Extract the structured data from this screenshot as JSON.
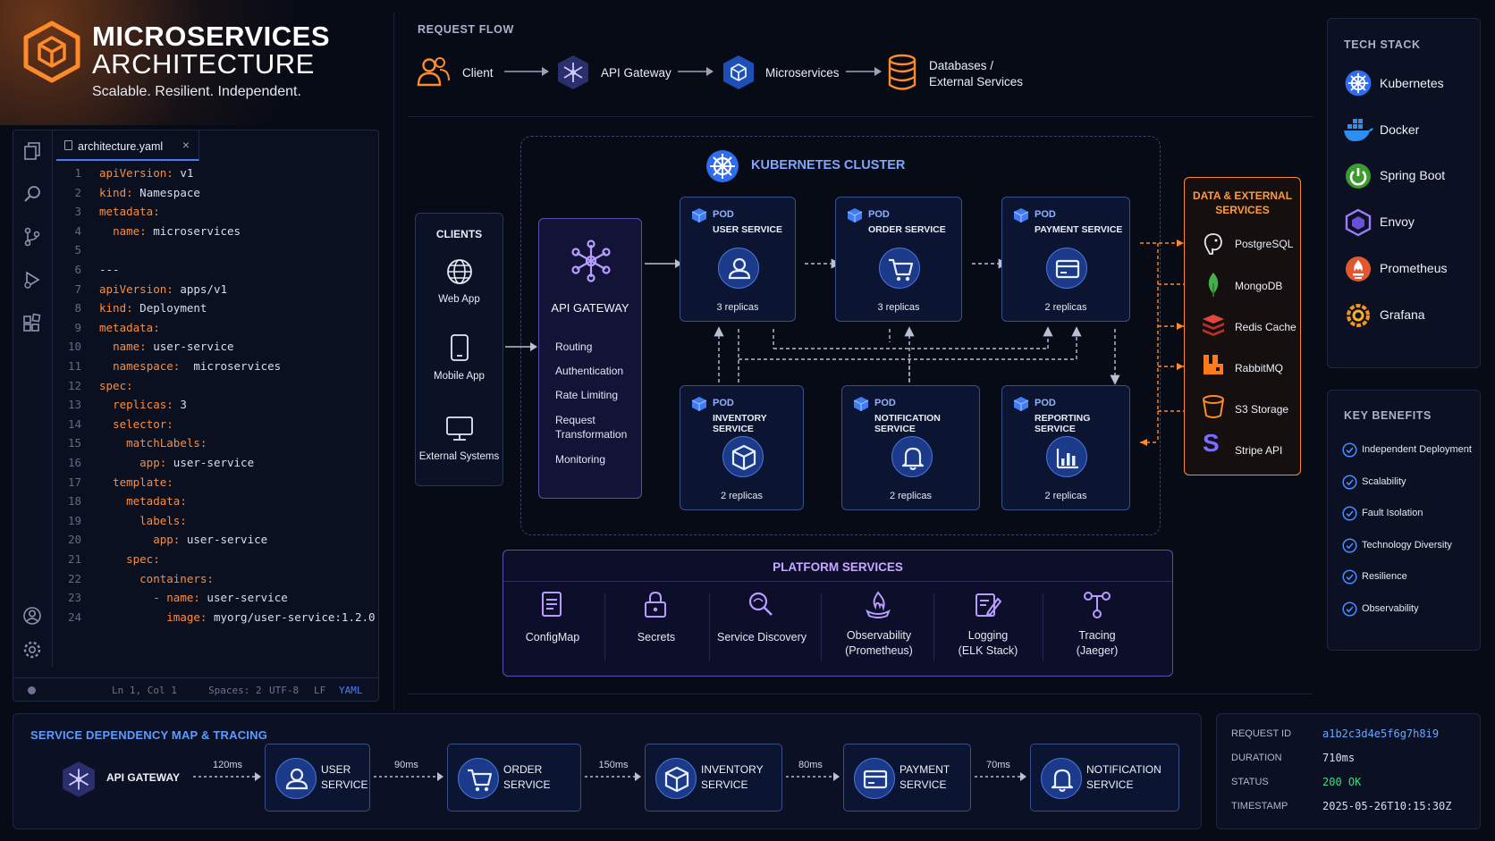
{
  "title": {
    "line1": "MICROSERVICES",
    "line2": "ARCHITECTURE",
    "subtitle": "Scalable. Resilient. Independent."
  },
  "editor": {
    "tab_name": "architecture.yaml",
    "lines": [
      {
        "n": "1",
        "indent": "",
        "key": "apiVersion:",
        "val": " v1"
      },
      {
        "n": "2",
        "indent": "",
        "key": "kind:",
        "val": " Namespace"
      },
      {
        "n": "3",
        "indent": "",
        "key": "metadata:",
        "val": ""
      },
      {
        "n": "4",
        "indent": "  ",
        "key": "name:",
        "val": " microservices"
      },
      {
        "n": "5",
        "indent": "",
        "key": "",
        "val": ""
      },
      {
        "n": "6",
        "indent": "",
        "key": "",
        "val": "---"
      },
      {
        "n": "7",
        "indent": "",
        "key": "apiVersion:",
        "val": " apps/v1"
      },
      {
        "n": "8",
        "indent": "",
        "key": "kind:",
        "val": " Deployment"
      },
      {
        "n": "9",
        "indent": "",
        "key": "metadata:",
        "val": ""
      },
      {
        "n": "10",
        "indent": "  ",
        "key": "name:",
        "val": " user-service"
      },
      {
        "n": "11",
        "indent": "  ",
        "key": "namespace:",
        "val": "  microservices"
      },
      {
        "n": "12",
        "indent": "",
        "key": "spec:",
        "val": ""
      },
      {
        "n": "13",
        "indent": "  ",
        "key": "replicas:",
        "val": " 3"
      },
      {
        "n": "14",
        "indent": "  ",
        "key": "selector:",
        "val": ""
      },
      {
        "n": "15",
        "indent": "    ",
        "key": "matchLabels:",
        "val": ""
      },
      {
        "n": "16",
        "indent": "      ",
        "key": "app:",
        "val": " user-service"
      },
      {
        "n": "17",
        "indent": "  ",
        "key": "template:",
        "val": ""
      },
      {
        "n": "18",
        "indent": "    ",
        "key": "metadata:",
        "val": ""
      },
      {
        "n": "19",
        "indent": "      ",
        "key": "labels:",
        "val": ""
      },
      {
        "n": "20",
        "indent": "        ",
        "key": "app:",
        "val": " user-service"
      },
      {
        "n": "21",
        "indent": "    ",
        "key": "spec:",
        "val": ""
      },
      {
        "n": "22",
        "indent": "      ",
        "key": "containers:",
        "val": ""
      },
      {
        "n": "23",
        "indent": "        ",
        "key": "- name:",
        "val": " user-service"
      },
      {
        "n": "24",
        "indent": "          ",
        "key": "image:",
        "val": " myorg/user-service:1.2.0"
      }
    ],
    "status": {
      "position": "Ln 1, Col 1",
      "spaces": "Spaces: 2",
      "encoding": "UTF-8",
      "eol": "LF",
      "language": "YAML"
    }
  },
  "request_flow": {
    "label": "REQUEST FLOW",
    "steps": [
      "Client",
      "API Gateway",
      "Microservices"
    ],
    "last_step": {
      "line1": "Databases /",
      "line2": "External Services"
    }
  },
  "cluster": {
    "title": "KUBERNETES CLUSTER"
  },
  "clients": {
    "title": "CLIENTS",
    "items": [
      "Web App",
      "Mobile App",
      "External Systems"
    ]
  },
  "gateway": {
    "title": "API GATEWAY",
    "items": [
      "Routing",
      "Authentication",
      "Rate Limiting",
      "Request",
      "Transformation",
      "Monitoring"
    ]
  },
  "pods": [
    {
      "tag": "POD",
      "name": "USER SERVICE",
      "replicas": "3 replicas",
      "icon": "user-icon"
    },
    {
      "tag": "POD",
      "name": "ORDER SERVICE",
      "replicas": "3 replicas",
      "icon": "cart-icon"
    },
    {
      "tag": "POD",
      "name": "PAYMENT SERVICE",
      "replicas": "2 replicas",
      "icon": "card-icon"
    },
    {
      "tag": "POD",
      "name": "INVENTORY SERVICE",
      "replicas": "2 replicas",
      "icon": "box-icon"
    },
    {
      "tag": "POD",
      "name": "NOTIFICATION SERVICE",
      "replicas": "2 replicas",
      "icon": "bell-icon"
    },
    {
      "tag": "POD",
      "name": "REPORTING SERVICE",
      "replicas": "2 replicas",
      "icon": "bar-chart-icon"
    }
  ],
  "data_external": {
    "title_line1": "DATA & EXTERNAL",
    "title_line2": "SERVICES",
    "items": [
      "PostgreSQL",
      "MongoDB",
      "Redis Cache",
      "RabbitMQ",
      "S3 Storage",
      "Stripe API"
    ]
  },
  "tech_stack": {
    "title": "TECH STACK",
    "items": [
      "Kubernetes",
      "Docker",
      "Spring Boot",
      "Envoy",
      "Prometheus",
      "Grafana"
    ]
  },
  "benefits": {
    "title": "KEY BENEFITS",
    "items": [
      "Independent Deployment",
      "Scalability",
      "Fault Isolation",
      "Technology Diversity",
      "Resilience",
      "Observability"
    ]
  },
  "platform": {
    "title": "PLATFORM SERVICES",
    "items": [
      {
        "l1": "ConfigMap",
        "l2": ""
      },
      {
        "l1": "Secrets",
        "l2": ""
      },
      {
        "l1": "Service Discovery",
        "l2": ""
      },
      {
        "l1": "Observability",
        "l2": "(Prometheus)"
      },
      {
        "l1": "Logging",
        "l2": "(ELK Stack)"
      },
      {
        "l1": "Tracing",
        "l2": "(Jaeger)"
      }
    ]
  },
  "dependency_map": {
    "title": "SERVICE DEPENDENCY MAP & TRACING",
    "gateway": "API GATEWAY",
    "latencies": [
      "120ms",
      "90ms",
      "150ms",
      "80ms",
      "70ms"
    ],
    "services": [
      {
        "l1": "USER",
        "l2": "SERVICE"
      },
      {
        "l1": "ORDER",
        "l2": "SERVICE"
      },
      {
        "l1": "INVENTORY",
        "l2": "SERVICE"
      },
      {
        "l1": "PAYMENT",
        "l2": "SERVICE"
      },
      {
        "l1": "NOTIFICATION",
        "l2": "SERVICE"
      }
    ]
  },
  "trace": {
    "request_id_label": "REQUEST ID",
    "request_id": "a1b2c3d4e5f6g7h8i9",
    "duration_label": "DURATION",
    "duration": "710ms",
    "status_label": "STATUS",
    "status": "200 OK",
    "timestamp_label": "TIMESTAMP",
    "timestamp": "2025-05-26T10:15:30Z"
  },
  "colors": {
    "accent_orange": "#ff8a2a",
    "accent_blue": "#4a7cff",
    "pod_label": "#8fb2ff",
    "status_ok": "#3ddc84",
    "trace_id": "#6aa8ff"
  }
}
